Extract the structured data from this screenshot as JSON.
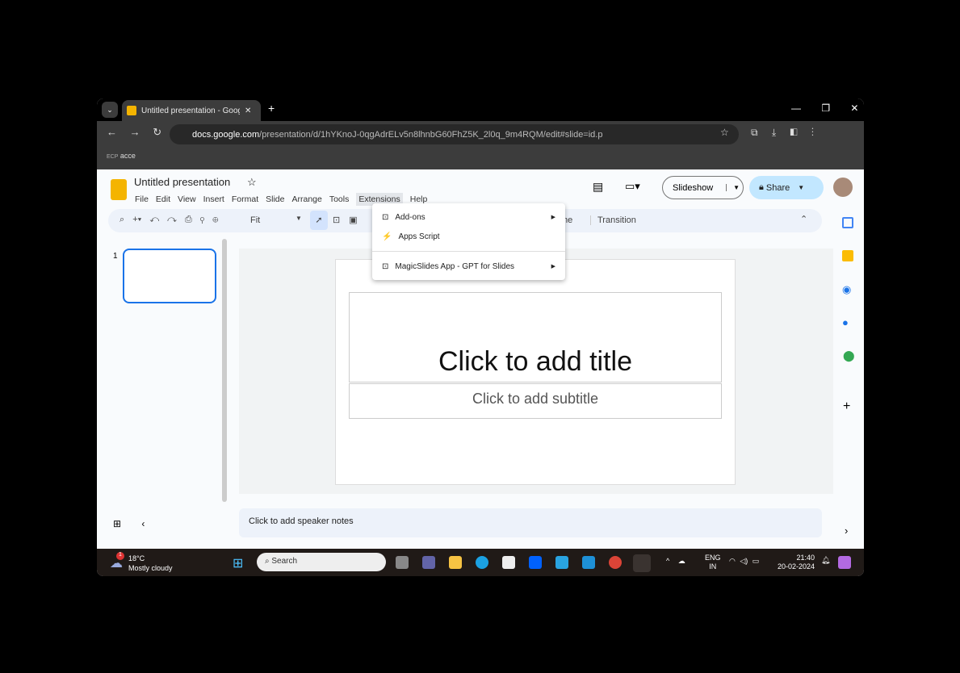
{
  "browser": {
    "tab_title": "Untitled presentation - Google S",
    "url_domain": "docs.google.com",
    "url_path": "/presentation/d/1hYKnoJ-0qgAdrELv5n8lhnbG60FhZ5K_2l0q_9m4RQM/edit#slide=id.p",
    "bookmark": "acce",
    "bookmark_icon": "ECP"
  },
  "doc": {
    "title": "Untitled presentation",
    "menu": [
      "File",
      "Edit",
      "View",
      "Insert",
      "Format",
      "Slide",
      "Arrange",
      "Tools",
      "Extensions",
      "Help"
    ],
    "slideshow": "Slideshow",
    "share": "Share",
    "zoom": "Fit",
    "transition": "Transition",
    "theme_partial": "me"
  },
  "extensions_menu": {
    "items": [
      "Add-ons",
      "Apps Script",
      "MagicSlides App - GPT for Slides"
    ]
  },
  "slide": {
    "number": "1",
    "title_placeholder": "Click to add title",
    "subtitle_placeholder": "Click to add subtitle",
    "notes_placeholder": "Click to add speaker notes"
  },
  "taskbar": {
    "temp": "18°C",
    "weather": "Mostly cloudy",
    "weather_badge": "1",
    "search": "Search",
    "lang1": "ENG",
    "lang2": "IN",
    "time": "21:40",
    "date": "20-02-2024"
  }
}
